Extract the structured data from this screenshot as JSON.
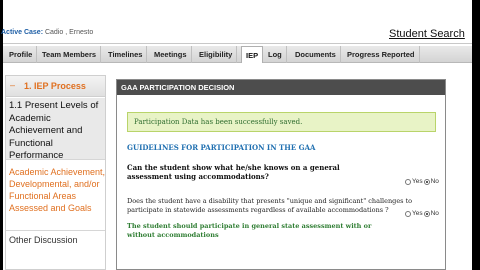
{
  "header": {
    "active_case_label": "Active Case:",
    "active_case_name": "Cadio , Ernesto",
    "student_search": "Student Search"
  },
  "tabs": [
    {
      "label": "Profile"
    },
    {
      "label": "Team Members"
    },
    {
      "label": "Timelines"
    },
    {
      "label": "Meetings"
    },
    {
      "label": "Eligibility"
    },
    {
      "label": "IEP",
      "active": true
    },
    {
      "label": "Log"
    },
    {
      "label": "Documents"
    },
    {
      "label": "Progress Reported"
    }
  ],
  "leftnav": {
    "section_title": "1. IEP Process",
    "collapse_icon": "minus-icon",
    "selected_item": "1.1 Present Levels of Academic Achievement and Functional Performance",
    "item2": "Academic Achievement, Developmental, and/or Functional Areas Assessed and Goals",
    "item3": "Other Discussion"
  },
  "panel": {
    "title": "GAA PARTICIPATION DECISION",
    "success_message": "Participation Data has been successfully saved.",
    "guidelines_title": "GUIDELINES FOR PARTICIPATION IN THE GAA",
    "q1": "Can the student show what he/she knows on a general assessment using accommodations?",
    "q2": "Does the student have a disability that presents \"unique and significant\" challenges to participate in statewide assessments regardless of available accommodations ?",
    "q3": "The student should participate in general state assessment with or without accommodations",
    "yes_label": "Yes",
    "no_label": "No",
    "q1_answer": "No",
    "q2_answer": "No"
  }
}
